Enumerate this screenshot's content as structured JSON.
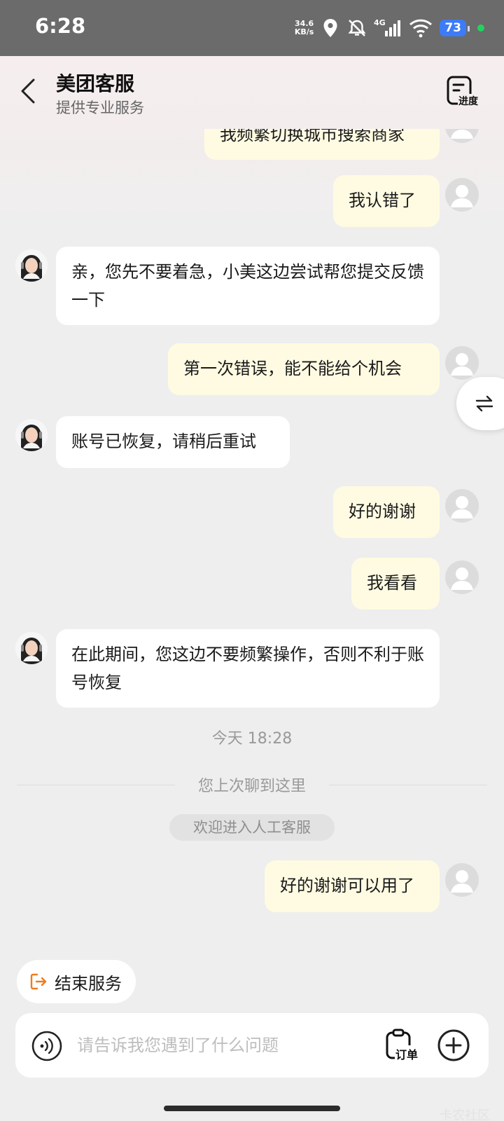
{
  "status_bar": {
    "time": "6:28",
    "net_speed_value": "34.6",
    "net_speed_unit": "KB/s",
    "network": "4G",
    "battery": "73"
  },
  "header": {
    "title": "美团客服",
    "subtitle": "提供专业服务",
    "progress_label": "进度"
  },
  "messages": [
    {
      "from": "user",
      "text": "我频繁切换城市搜索商家"
    },
    {
      "from": "user",
      "text": "我认错了"
    },
    {
      "from": "agent",
      "text": "亲，您先不要着急，小美这边尝试帮您提交反馈一下"
    },
    {
      "from": "user",
      "text": "第一次错误，能不能给个机会"
    },
    {
      "from": "agent",
      "text": "账号已恢复，请稍后重试"
    },
    {
      "from": "user",
      "text": "好的谢谢"
    },
    {
      "from": "user",
      "text": "我看看"
    },
    {
      "from": "agent",
      "text": "在此期间，您这边不要频繁操作，否则不利于账号恢复"
    },
    {
      "from": "user",
      "text": "好的谢谢可以用了"
    }
  ],
  "system": {
    "timestamp": "今天 18:28",
    "last_chat_marker": "您上次聊到这里",
    "welcome": "欢迎进入人工客服"
  },
  "actions": {
    "end_service": "结束服务"
  },
  "input": {
    "placeholder": "请告诉我您遇到了什么问题",
    "value": "",
    "order_label": "订单"
  },
  "colors": {
    "user_bubble": "#fffbe2",
    "agent_bubble": "#ffffff",
    "end_service_icon": "#f07c1a"
  },
  "watermark": "卡农社区"
}
